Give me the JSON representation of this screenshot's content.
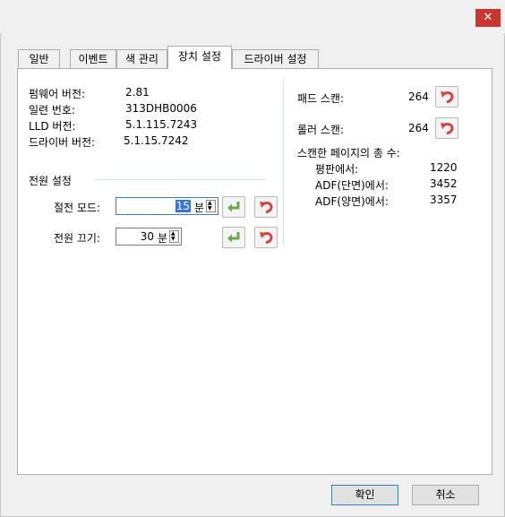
{
  "window": {
    "close_label": "✕"
  },
  "tabs": [
    {
      "label": "일반"
    },
    {
      "label": "이벤트"
    },
    {
      "label": "색 관리"
    },
    {
      "label": "장치 설정"
    },
    {
      "label": "드라이버 설정"
    }
  ],
  "device_info": {
    "firmware_label": "펌웨어 버전:",
    "firmware_value": "2.81",
    "serial_label": "일련 번호:",
    "serial_value": "313DHB0006",
    "lld_label": "LLD 버전:",
    "lld_value": "5.1.115.7243",
    "driver_label": "드라이버 버전:",
    "driver_value": "5.1.15.7242"
  },
  "power": {
    "group_label": "전원 설정",
    "sleep_label": "절전 모드:",
    "sleep_value": "15",
    "sleep_unit": "분",
    "off_label": "전원 끄기:",
    "off_value": "30",
    "off_unit": "분"
  },
  "counters": {
    "pad_label": "패드 스캔:",
    "pad_value": "264",
    "roller_label": "롤러 스캔:",
    "roller_value": "264",
    "total_label": "스캔한 페이지의 총 수:",
    "flatbed_label": "평판에서:",
    "flatbed_value": "1220",
    "adf_simplex_label": "ADF(단면)에서:",
    "adf_simplex_value": "3452",
    "adf_duplex_label": "ADF(양면)에서:",
    "adf_duplex_value": "3357"
  },
  "buttons": {
    "ok": "확인",
    "cancel": "취소"
  },
  "colors": {
    "close": "#c7372f",
    "accept_icon": "#6aa84f",
    "reset_icon": "#d64541"
  },
  "icons": {
    "accept": "enter-arrow-icon",
    "reset": "undo-arrow-icon"
  }
}
